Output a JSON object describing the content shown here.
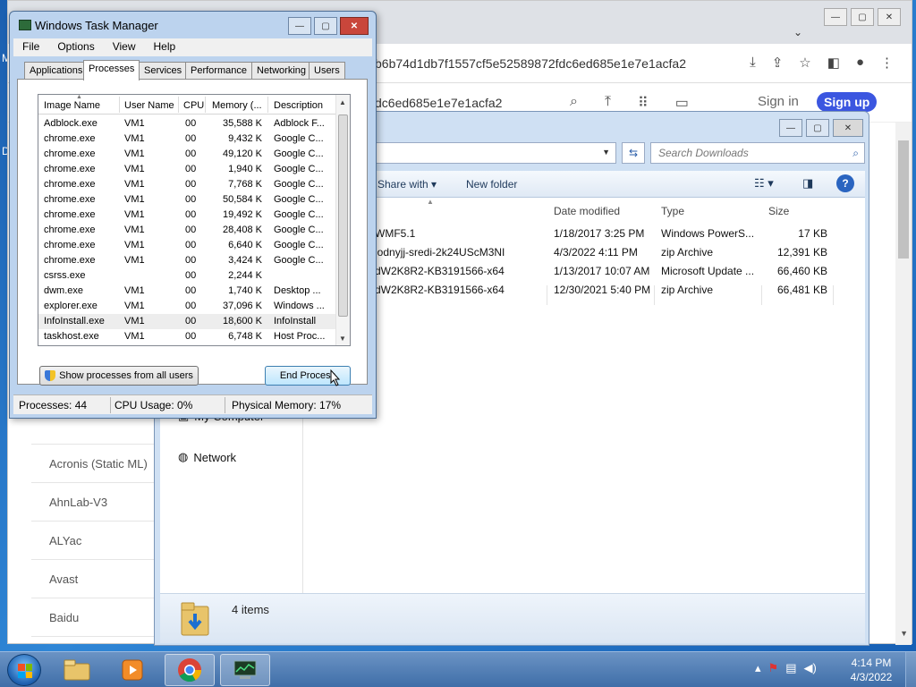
{
  "desktop": {
    "frag_m": "M",
    "frag_d": "D"
  },
  "chrome": {
    "url_text": "b6b74d1db7f1557cf5e52589872fdc6ed685e1e7e1acfa2",
    "page_hash": "dc6ed685e1e7e1acfa2",
    "sign_in": "Sign in",
    "sign_up": "Sign up",
    "sidebar_items": [
      "Acronis (Static ML)",
      "AhnLab-V3",
      "ALYac",
      "Avast",
      "Baidu"
    ]
  },
  "explorer": {
    "search_placeholder": "Search Downloads",
    "share_with": "Share with",
    "new_folder": "New folder",
    "columns": {
      "date": "Date modified",
      "type": "Type",
      "size": "Size"
    },
    "files": [
      {
        "name": "WMF5.1",
        "date": "1/18/2017 3:25 PM",
        "type": "Windows PowerS...",
        "size": "17 KB"
      },
      {
        "name": "lodnyjj-sredi-2k24UScM3NI",
        "date": "4/3/2022 4:11 PM",
        "type": "zip Archive",
        "size": "12,391 KB"
      },
      {
        "name": "dW2K8R2-KB3191566-x64",
        "date": "1/13/2017 10:07 AM",
        "type": "Microsoft Update ...",
        "size": "66,460 KB"
      },
      {
        "name": "dW2K8R2-KB3191566-x64",
        "date": "12/30/2021 5:40 PM",
        "type": "zip Archive",
        "size": "66,481 KB"
      }
    ],
    "nav": {
      "my_computer": "My Computer",
      "network": "Network"
    },
    "status_items": "4 items"
  },
  "taskmanager": {
    "title": "Windows Task Manager",
    "menu": [
      "File",
      "Options",
      "View",
      "Help"
    ],
    "tabs": [
      "Applications",
      "Processes",
      "Services",
      "Performance",
      "Networking",
      "Users"
    ],
    "active_tab": "Processes",
    "headers": {
      "image": "Image Name",
      "user": "User Name",
      "cpu": "CPU",
      "memory": "Memory (...",
      "description": "Description"
    },
    "processes": [
      {
        "image": "Adblock.exe",
        "user": "VM1",
        "cpu": "00",
        "memory": "35,588 K",
        "description": "Adblock F..."
      },
      {
        "image": "chrome.exe",
        "user": "VM1",
        "cpu": "00",
        "memory": "9,432 K",
        "description": "Google C..."
      },
      {
        "image": "chrome.exe",
        "user": "VM1",
        "cpu": "00",
        "memory": "49,120 K",
        "description": "Google C..."
      },
      {
        "image": "chrome.exe",
        "user": "VM1",
        "cpu": "00",
        "memory": "1,940 K",
        "description": "Google C..."
      },
      {
        "image": "chrome.exe",
        "user": "VM1",
        "cpu": "00",
        "memory": "7,768 K",
        "description": "Google C..."
      },
      {
        "image": "chrome.exe",
        "user": "VM1",
        "cpu": "00",
        "memory": "50,584 K",
        "description": "Google C..."
      },
      {
        "image": "chrome.exe",
        "user": "VM1",
        "cpu": "00",
        "memory": "19,492 K",
        "description": "Google C..."
      },
      {
        "image": "chrome.exe",
        "user": "VM1",
        "cpu": "00",
        "memory": "28,408 K",
        "description": "Google C..."
      },
      {
        "image": "chrome.exe",
        "user": "VM1",
        "cpu": "00",
        "memory": "6,640 K",
        "description": "Google C..."
      },
      {
        "image": "chrome.exe",
        "user": "VM1",
        "cpu": "00",
        "memory": "3,424 K",
        "description": "Google C..."
      },
      {
        "image": "csrss.exe",
        "user": "",
        "cpu": "00",
        "memory": "2,244 K",
        "description": ""
      },
      {
        "image": "dwm.exe",
        "user": "VM1",
        "cpu": "00",
        "memory": "1,740 K",
        "description": "Desktop ..."
      },
      {
        "image": "explorer.exe",
        "user": "VM1",
        "cpu": "00",
        "memory": "37,096 K",
        "description": "Windows ..."
      },
      {
        "image": "InfoInstall.exe",
        "user": "VM1",
        "cpu": "00",
        "memory": "18,600 K",
        "description": "InfoInstall"
      },
      {
        "image": "taskhost.exe",
        "user": "VM1",
        "cpu": "00",
        "memory": "6,748 K",
        "description": "Host Proc..."
      }
    ],
    "selected_process": "InfoInstall.exe",
    "show_all_button": "Show processes from all users",
    "end_process_button": "End Process",
    "status": {
      "processes": "Processes: 44",
      "cpu": "CPU Usage: 0%",
      "memory": "Physical Memory: 17%"
    }
  },
  "taskbar": {
    "time": "4:14 PM",
    "date": "4/3/2022",
    "apps": [
      "windows-explorer",
      "media-player",
      "chrome",
      "task-manager"
    ]
  },
  "colors": {
    "signup_bg": "#3b56e0",
    "taskbar": "#3f6ea8",
    "tm_frame": "#bcd3ee"
  }
}
